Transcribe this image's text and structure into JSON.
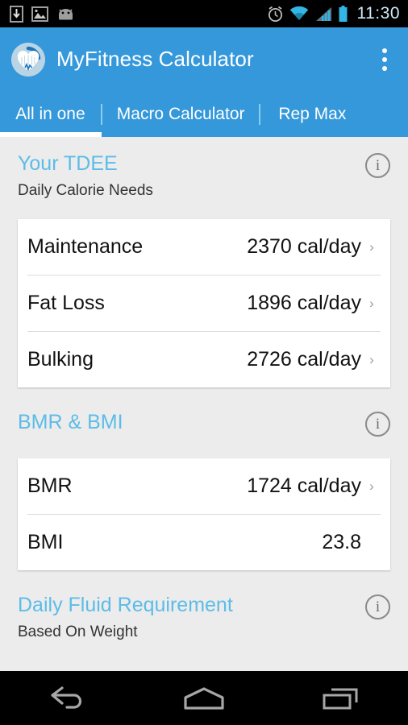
{
  "status_bar": {
    "icons_left": [
      "download-icon",
      "gallery-image-icon",
      "android-head-icon"
    ],
    "icons_right": [
      "alarm-clock-icon",
      "wifi-icon",
      "cell-signal-icon",
      "battery-icon"
    ],
    "time": "11:30"
  },
  "app_bar": {
    "logo_name": "myfitness-logo",
    "title": "MyFitness Calculator",
    "overflow_label": "More options"
  },
  "tabs": [
    {
      "label": "All in one",
      "active": true
    },
    {
      "label": "Macro Calculator",
      "active": false
    },
    {
      "label": "Rep Max",
      "active": false
    }
  ],
  "sections": [
    {
      "title": "Your TDEE",
      "subtitle": "Daily Calorie Needs",
      "info_label": "i",
      "rows": [
        {
          "label": "Maintenance",
          "value": "2370 cal/day",
          "chevron": "›"
        },
        {
          "label": "Fat Loss",
          "value": "1896 cal/day",
          "chevron": "›"
        },
        {
          "label": "Bulking",
          "value": "2726 cal/day",
          "chevron": "›"
        }
      ]
    },
    {
      "title": "BMR & BMI",
      "subtitle": "",
      "info_label": "i",
      "rows": [
        {
          "label": "BMR",
          "value": "1724 cal/day",
          "chevron": "›"
        },
        {
          "label": "BMI",
          "value": "23.8",
          "chevron": ""
        }
      ]
    },
    {
      "title": "Daily Fluid Requirement",
      "subtitle": "Based On Weight",
      "info_label": "i",
      "rows": []
    }
  ],
  "nav_bar": {
    "back_label": "Back",
    "home_label": "Home",
    "recents_label": "Recent apps"
  },
  "colors": {
    "primary": "#3498DB",
    "accent_heading": "#5CBCE8",
    "background": "#ECECEC",
    "card": "#FFFFFF",
    "status_bar": "#000000",
    "status_icon": "#33B5E5"
  }
}
